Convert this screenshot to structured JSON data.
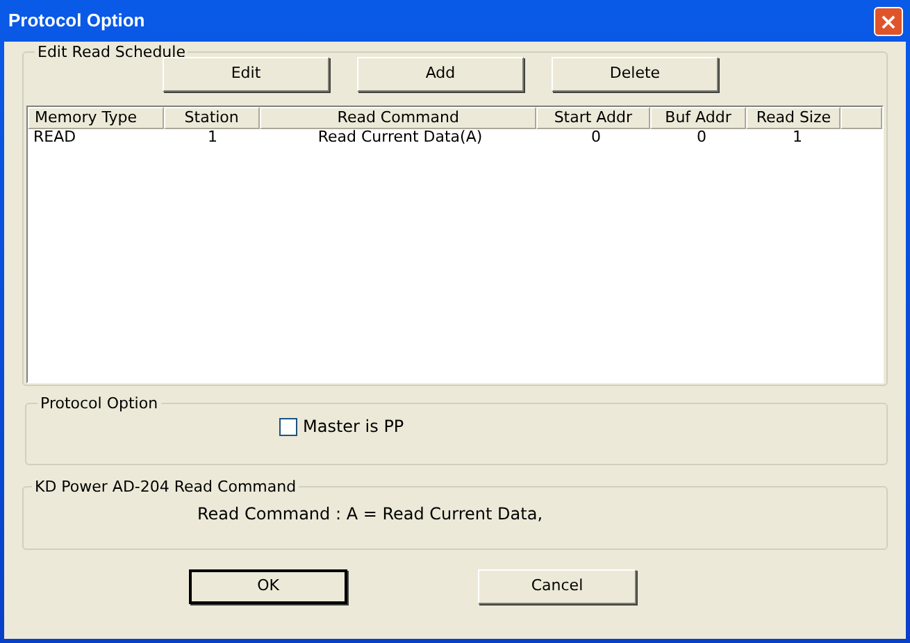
{
  "window": {
    "title": "Protocol Option",
    "close": "×"
  },
  "schedule": {
    "title": "Edit Read Schedule",
    "buttons": [
      "Edit",
      "Add",
      "Delete"
    ],
    "columns": [
      "Memory Type",
      "Station",
      "Read Command",
      "Start Addr",
      "Buf Addr",
      "Read Size"
    ],
    "rows": [
      [
        "READ",
        "1",
        "Read Current Data(A)",
        "0",
        "0",
        "1"
      ]
    ]
  },
  "protocol_option": {
    "title": "Protocol Option",
    "checkbox": {
      "label": "Master is PP",
      "checked": false
    }
  },
  "read_command": {
    "title": "KD Power AD-204 Read Command",
    "text": "Read Command : A = Read Current Data,"
  },
  "buttons": [
    {
      "label": "OK",
      "default": true
    },
    {
      "label": "Cancel",
      "default": false
    }
  ]
}
